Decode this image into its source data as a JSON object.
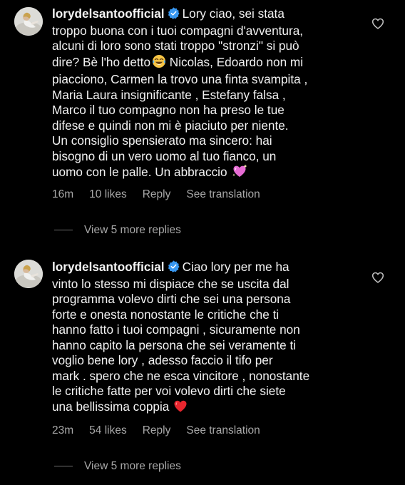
{
  "colors": {
    "background": "#000000",
    "text": "#f2f2f2",
    "muted": "#a8a8a8",
    "verified_badge": "#3897f0",
    "heart_emoji": "#e8262e",
    "sparkle_heart": "#e66bd3"
  },
  "comments": [
    {
      "username": "lorydelsantoofficial",
      "verified_icon": "verified-badge-icon",
      "lines": [
        "Lory ciao, sei stata",
        "troppo buona con i tuoi compagni d'avventura,",
        "alcuni di loro sono stati troppo \"stronzi\" si può",
        "dire? Bè  l'ho detto",
        " Nicolas, Edoardo non mi",
        "piacciono, Carmen la trovo una finta svampita ,",
        "Maria Laura insignificante , Estefany falsa ,",
        "Marco il tuo compagno  non ha preso le tue",
        "difese e quindi non mi è piaciuto per niente.",
        "Un consiglio spensierato ma sincero: hai",
        "bisogno di un vero uomo al tuo fianco, un",
        "uomo con le palle. Un abbraccio"
      ],
      "emojis": [
        "tears-of-joy-emoji",
        "sparkling-heart-emoji"
      ],
      "time": "16m",
      "likes": "10 likes",
      "reply_label": "Reply",
      "translation_label": "See translation",
      "view_replies": "View 5 more replies",
      "like_icon": "heart-outline-icon"
    },
    {
      "username": "lorydelsantoofficial",
      "verified_icon": "verified-badge-icon",
      "lines": [
        "Ciao lory per me ha",
        "vinto lo stesso mi dispiace che se uscita dal",
        "programma volevo dirti che sei una persona",
        "forte e onesta nonostante le critiche che ti",
        "hanno fatto i tuoi compagni , sicuramente non",
        "hanno capito la persona che sei veramente ti",
        "voglio bene lory , adesso faccio il tifo per",
        "mark . spero che ne esca vincitore , nonostante",
        "le critiche fatte per voi volevo dirti che siete",
        "una bellissima coppia"
      ],
      "emojis": [
        "red-heart-emoji"
      ],
      "time": "23m",
      "likes": "54 likes",
      "reply_label": "Reply",
      "translation_label": "See translation",
      "view_replies": "View 5 more replies",
      "like_icon": "heart-outline-icon"
    }
  ]
}
